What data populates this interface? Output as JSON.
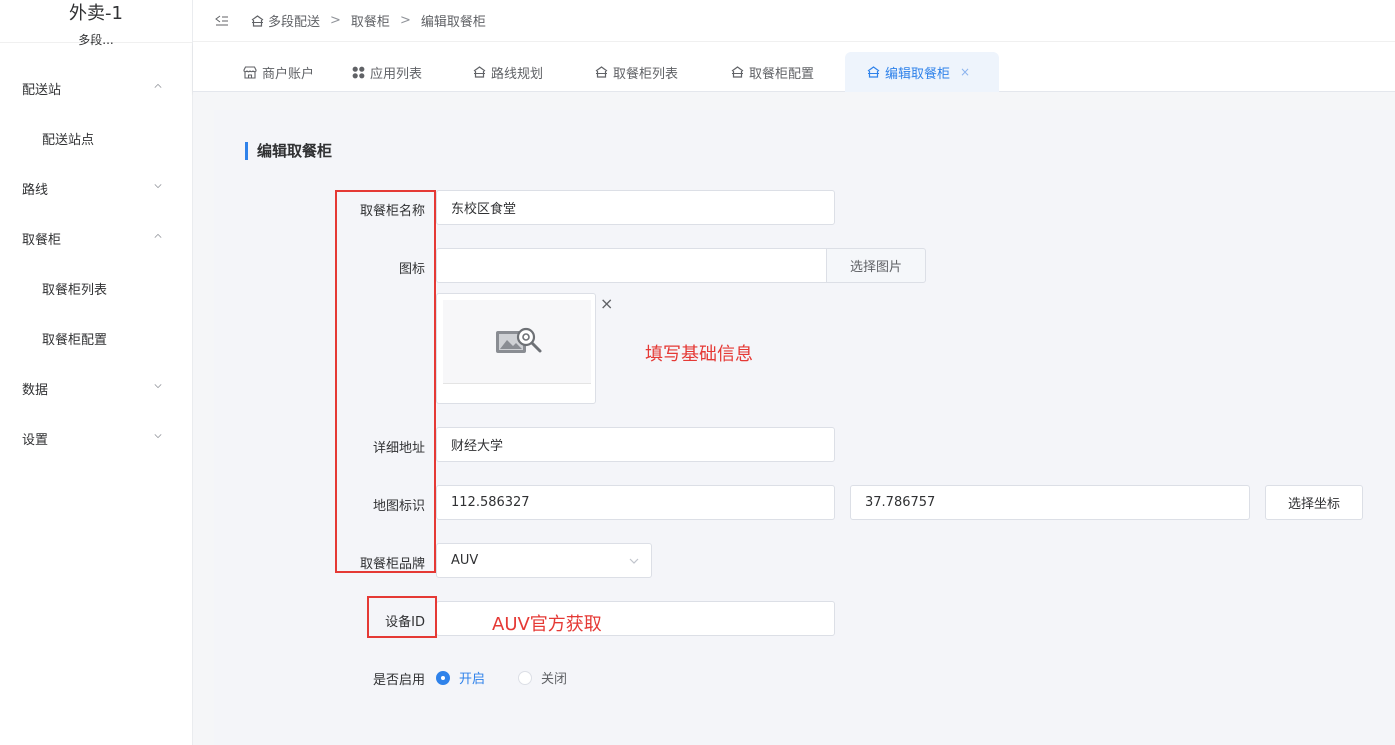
{
  "app": {
    "title": "外卖-1",
    "subtitle": "多段..."
  },
  "sidebar": {
    "groups": [
      {
        "label": "配送站",
        "expanded": true,
        "items": [
          "配送站点"
        ]
      },
      {
        "label": "路线",
        "expanded": false,
        "items": []
      },
      {
        "label": "取餐柜",
        "expanded": true,
        "items": [
          "取餐柜列表",
          "取餐柜配置"
        ]
      },
      {
        "label": "数据",
        "expanded": false,
        "items": []
      },
      {
        "label": "设置",
        "expanded": false,
        "items": []
      }
    ]
  },
  "breadcrumb": [
    "多段配送",
    "取餐柜",
    "编辑取餐柜"
  ],
  "tabs": [
    {
      "label": "商户账户",
      "icon": "shop-icon"
    },
    {
      "label": "应用列表",
      "icon": "apps-icon"
    },
    {
      "label": "路线规划",
      "icon": "home-icon"
    },
    {
      "label": "取餐柜列表",
      "icon": "home-icon"
    },
    {
      "label": "取餐柜配置",
      "icon": "home-icon"
    },
    {
      "label": "编辑取餐柜",
      "icon": "home-icon",
      "active": true,
      "close": "×"
    }
  ],
  "form": {
    "title": "编辑取餐柜",
    "name_label": "取餐柜名称",
    "name_value": "东校区食堂",
    "icon_label": "图标",
    "icon_value": "",
    "choose_image": "选择图片",
    "remove_image": "×",
    "address_label": "详细地址",
    "address_value": "财经大学",
    "map_label": "地图标识",
    "lng_value": "112.586327",
    "lat_value": "37.786757",
    "choose_coord": "选择坐标",
    "brand_label": "取餐柜品牌",
    "brand_value": "AUV",
    "device_label": "设备ID",
    "device_value": "",
    "enable_label": "是否启用",
    "enable_on": "开启",
    "enable_off": "关闭",
    "enabled": true
  },
  "annotations": {
    "basic_info": "填写基础信息",
    "device_hint": "AUV官方获取"
  },
  "colors": {
    "accent": "#2f82ea",
    "annotation": "#e53935"
  }
}
